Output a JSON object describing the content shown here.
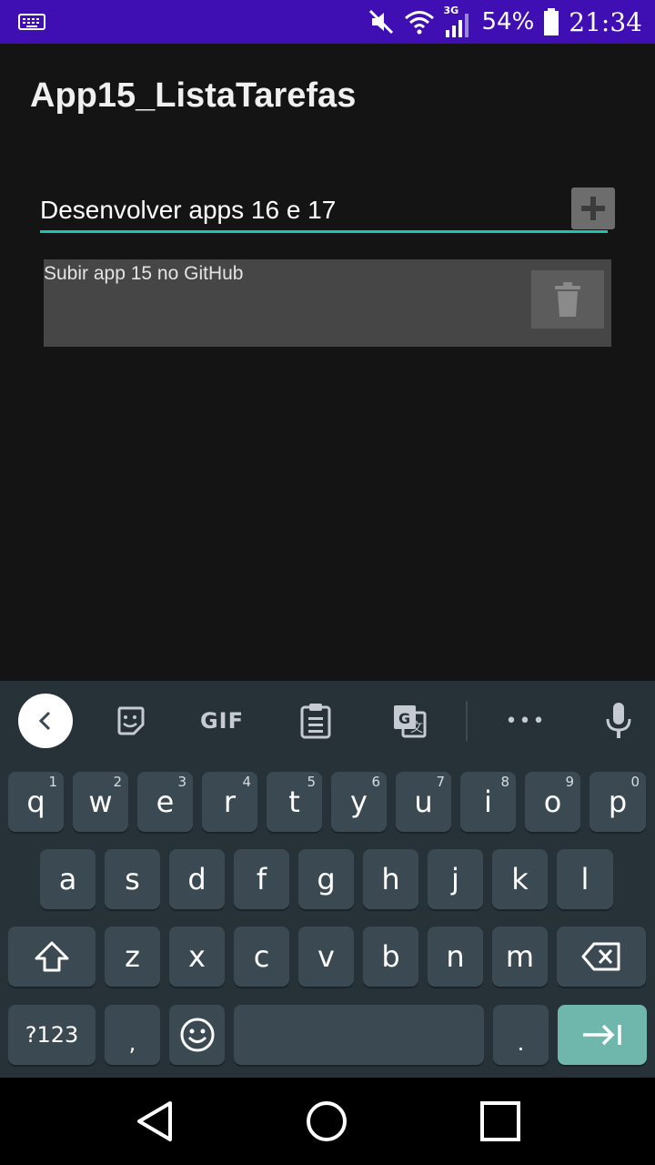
{
  "status_bar": {
    "battery_percent": "54%",
    "network_type": "3G",
    "time": "21:34",
    "icons": [
      "keyboard-icon",
      "mute-icon",
      "wifi-icon",
      "signal-icon",
      "battery-icon"
    ]
  },
  "app": {
    "title": "App15_ListaTarefas",
    "input_value": "Desenvolver apps 16 e 17",
    "add_button_icon": "plus-icon",
    "tasks": [
      {
        "text": "Subir app 15 no GitHub",
        "delete_icon": "trash-icon"
      }
    ],
    "accent_color": "#19c6b0"
  },
  "keyboard": {
    "toolbar": {
      "back_icon": "chevron-left-icon",
      "sticker_icon": "sticker-icon",
      "gif_label": "GIF",
      "clipboard_icon": "clipboard-icon",
      "translate_icon": "translate-icon",
      "more_label": "•••",
      "mic_icon": "mic-icon"
    },
    "row1": [
      {
        "k": "q",
        "h": "1"
      },
      {
        "k": "w",
        "h": "2"
      },
      {
        "k": "e",
        "h": "3"
      },
      {
        "k": "r",
        "h": "4"
      },
      {
        "k": "t",
        "h": "5"
      },
      {
        "k": "y",
        "h": "6"
      },
      {
        "k": "u",
        "h": "7"
      },
      {
        "k": "i",
        "h": "8"
      },
      {
        "k": "o",
        "h": "9"
      },
      {
        "k": "p",
        "h": "0"
      }
    ],
    "row2": [
      "a",
      "s",
      "d",
      "f",
      "g",
      "h",
      "j",
      "k",
      "l"
    ],
    "row3": [
      "z",
      "x",
      "c",
      "v",
      "b",
      "n",
      "m"
    ],
    "symbols_label": "?123",
    "comma_label": ",",
    "period_label": ".",
    "enter_color": "#6fb7ad"
  },
  "nav_bar": {
    "back_icon": "triangle-back-icon",
    "home_icon": "circle-home-icon",
    "recents_icon": "square-recents-icon"
  }
}
